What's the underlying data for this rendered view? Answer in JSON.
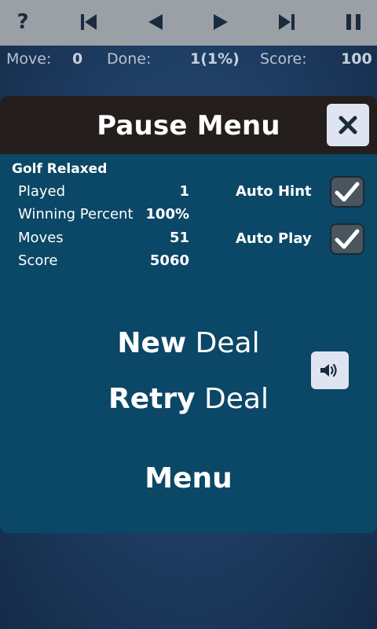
{
  "toolbar": {
    "help_icon": "?",
    "buttons": [
      "help-icon",
      "skip-to-start-icon",
      "step-back-icon",
      "step-forward-icon",
      "skip-to-end-icon",
      "pause-icon"
    ]
  },
  "stats": {
    "move_label": "Move:",
    "move_value": "0",
    "done_label": "Done:",
    "done_value": "1(1%)",
    "score_label": "Score:",
    "score_value": "100"
  },
  "pause_menu": {
    "title": "Pause Menu",
    "game_name": "Golf Relaxed",
    "stats": [
      {
        "label": "Played",
        "value": "1"
      },
      {
        "label": "Winning Percent",
        "value": "100%"
      },
      {
        "label": "Moves",
        "value": "51"
      },
      {
        "label": "Score",
        "value": "5060"
      }
    ],
    "options": [
      {
        "label": "Auto Hint",
        "checked": true
      },
      {
        "label": "Auto Play",
        "checked": true
      }
    ],
    "new_deal": {
      "bold": "New",
      "rest": " Deal"
    },
    "retry_deal": {
      "bold": "Retry",
      "rest": " Deal"
    },
    "menu": "Menu"
  },
  "colors": {
    "toolbar_bg": "#9aa0a6",
    "panel_bg": "#0b4766",
    "header_bg": "#241f1d",
    "button_bg": "#dfe5f0",
    "icon_dark": "#1b2b3e"
  }
}
